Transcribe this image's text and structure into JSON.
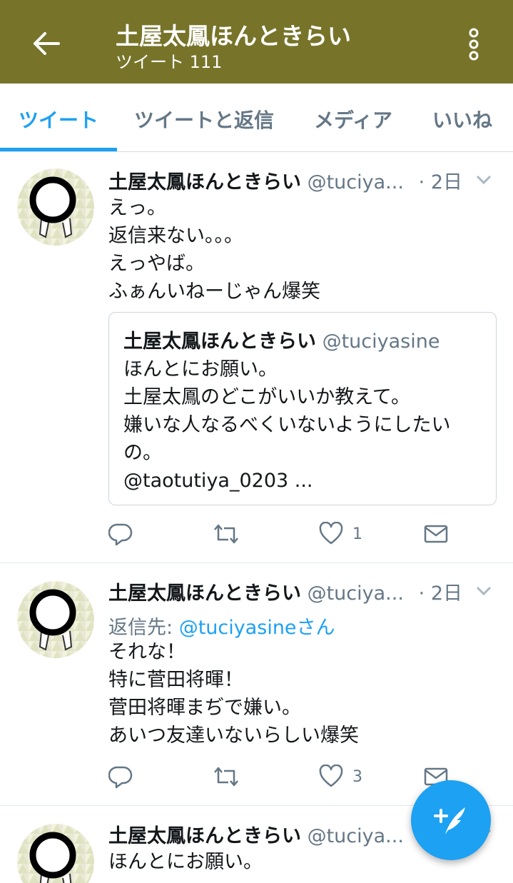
{
  "header": {
    "title": "土屋太鳳ほんときらい",
    "subtitle": "ツイート 111",
    "back_icon": "arrow-left-icon",
    "more_icon": "more-vertical-icon",
    "bar_color": "#77742a"
  },
  "tabs": [
    {
      "label": "ツイート",
      "active": true
    },
    {
      "label": "ツイートと返信",
      "active": false
    },
    {
      "label": "メディア",
      "active": false
    },
    {
      "label": "いいね",
      "active": false
    }
  ],
  "tweets": [
    {
      "name": "土屋太鳳ほんときらい",
      "handle": "@tuciya...",
      "time": "· 2日",
      "text": "えっ。\n返信来ない。。。\nえっやば。\nふぁんいねーじゃん爆笑",
      "quote": {
        "name": "土屋太鳳ほんときらい",
        "handle": "@tuciyasine",
        "text": "ほんとにお願い。\n土屋太鳳のどこがいいか教えて。\n嫌いな人なるべくいないようにしたいの。\n@taotutiya_0203 ..."
      },
      "like_count": "1"
    },
    {
      "name": "土屋太鳳ほんときらい",
      "handle": "@tuciya...",
      "time": "· 2日",
      "reply_prefix": "返信先: ",
      "reply_to": "@tuciyasineさん",
      "text": "それな！\n特に菅田将暉！\n菅田将暉まぢで嫌い。\nあいつ友達いないらしい爆笑",
      "like_count": "3"
    },
    {
      "name": "土屋太鳳ほんときらい",
      "handle": "@tuciya...",
      "text": "ほんとにお願い。"
    }
  ],
  "colors": {
    "accent": "#1da1f2",
    "secondary_text": "#657786"
  },
  "fab": {
    "icon": "compose-tweet-icon"
  }
}
